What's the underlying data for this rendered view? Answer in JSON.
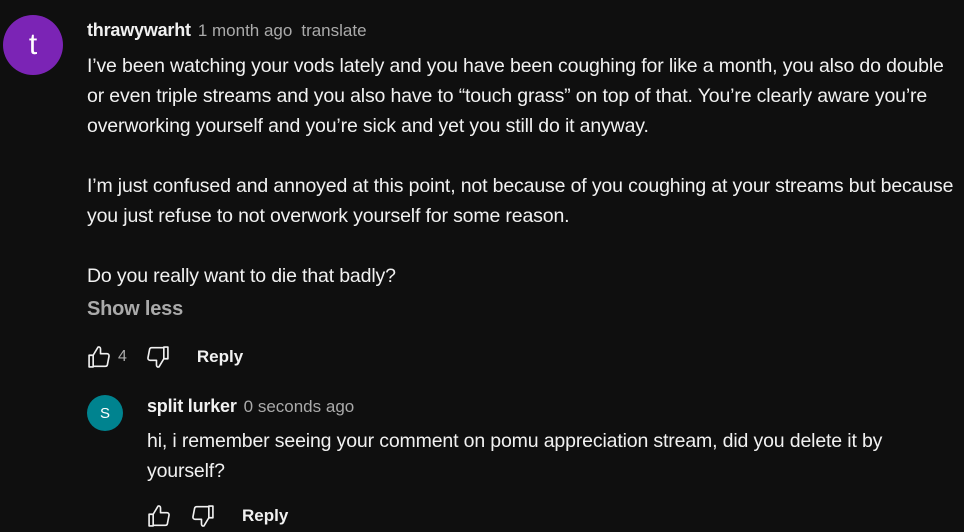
{
  "comment": {
    "avatar_letter": "t",
    "avatar_color": "#7b24b5",
    "author": "thrawywarht",
    "timestamp": "1 month ago",
    "translate_label": "translate",
    "paragraphs": [
      "I’ve been watching your vods lately and you have been coughing for like a month, you also do double or even triple streams and you also have to “touch grass” on top of that. You’re clearly aware you’re overworking yourself and you’re sick and yet you still do it anyway.",
      "I’m just confused and annoyed at this point, not because of you coughing at your streams but because you just refuse to not overwork yourself for some reason.",
      "Do you really want to die that badly?"
    ],
    "show_less_label": "Show less",
    "like_icon": "thumbs-up-icon",
    "like_count": "4",
    "dislike_icon": "thumbs-down-icon",
    "reply_label": "Reply"
  },
  "reply": {
    "avatar_letter": "S",
    "avatar_color": "#00838f",
    "author": "split lurker",
    "timestamp": "0 seconds ago",
    "text": "hi, i remember seeing your comment on pomu appreciation stream, did you delete it by yourself?",
    "like_icon": "thumbs-up-icon",
    "dislike_icon": "thumbs-down-icon",
    "reply_label": "Reply"
  }
}
